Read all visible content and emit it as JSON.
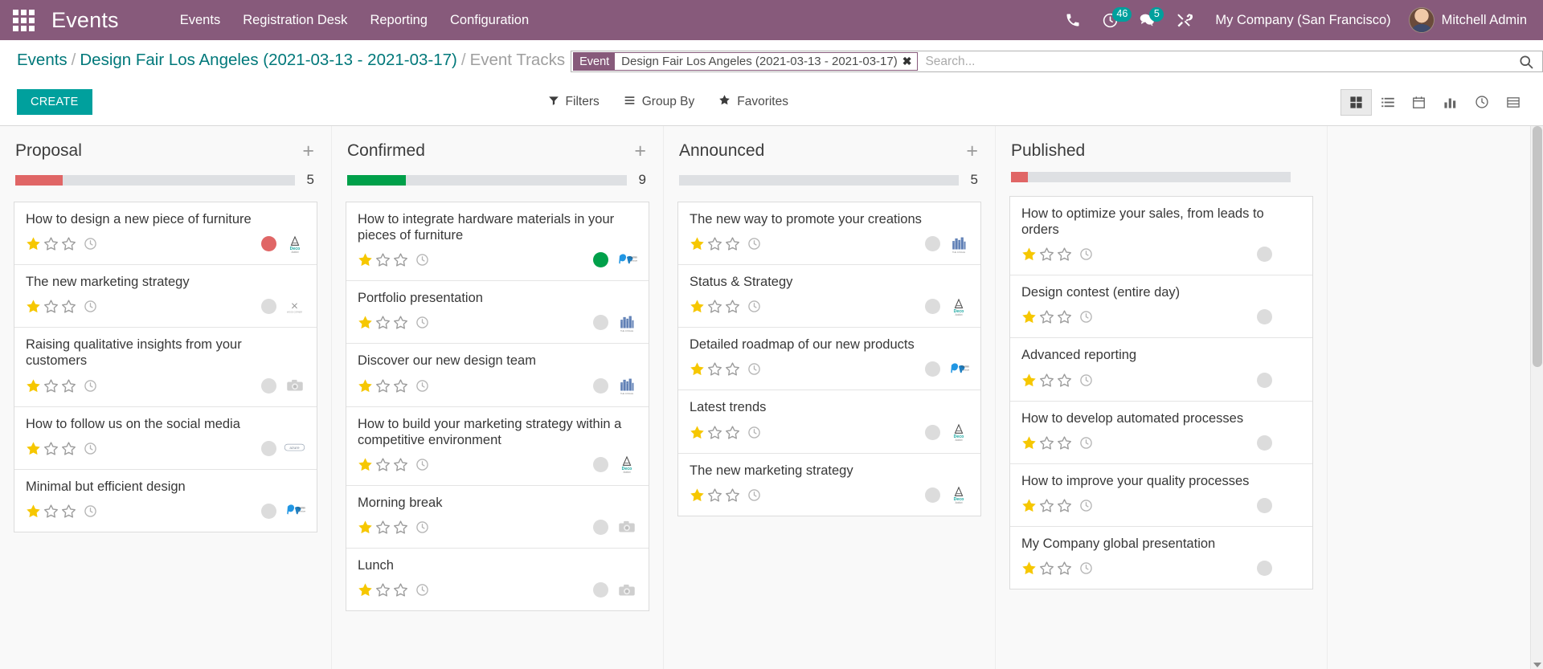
{
  "navbar": {
    "apps_icon": "apps-grid-icon",
    "brand": "Events",
    "menu": [
      {
        "label": "Events"
      },
      {
        "label": "Registration Desk"
      },
      {
        "label": "Reporting"
      },
      {
        "label": "Configuration"
      }
    ],
    "icons": {
      "phone": "phone-icon",
      "activity": "clock-icon",
      "activity_count": "46",
      "messages": "chat-icon",
      "messages_count": "5",
      "tools": "tools-icon"
    },
    "company": "My Company (San Francisco)",
    "user": "Mitchell Admin",
    "bg_color": "#875a7b",
    "badge_color": "#00a09d"
  },
  "breadcrumb": {
    "root": "Events",
    "parent": "Design Fair Los Angeles (2021-03-13 - 2021-03-17)",
    "current": "Event Tracks",
    "separator": "/"
  },
  "search": {
    "facet_label": "Event",
    "facet_value": "Design Fair Los Angeles (2021-03-13 - 2021-03-17)",
    "facet_close": "✖",
    "placeholder": "Search...",
    "value": "",
    "search_icon": "search-icon"
  },
  "toolbar": {
    "create_label": "CREATE",
    "filters_label": "Filters",
    "group_by_label": "Group By",
    "favorites_label": "Favorites",
    "create_color": "#00a09d",
    "views": [
      {
        "name": "kanban",
        "icon": "kanban-icon",
        "active": true
      },
      {
        "name": "list",
        "icon": "list-icon",
        "active": false
      },
      {
        "name": "calendar",
        "icon": "calendar-icon",
        "active": false
      },
      {
        "name": "graph",
        "icon": "graph-icon",
        "active": false
      },
      {
        "name": "gantt",
        "icon": "clock-circle-icon",
        "active": false
      },
      {
        "name": "pivot",
        "icon": "pivot-icon",
        "active": false
      }
    ]
  },
  "kanban": {
    "columns": [
      {
        "title": "Proposal",
        "count": "5",
        "progress_percent": 17,
        "progress_color": "#e06666",
        "add_icon": "plus-icon",
        "cards": [
          {
            "title": "How to design a new piece of furniture",
            "stars": 1,
            "dot_color": "#e06666",
            "logo": "deco-addict-logo",
            "clock": "clock-icon"
          },
          {
            "title": "The new marketing strategy",
            "stars": 1,
            "dot_color": "#dcdcdc",
            "logo": "wood-corner-logo",
            "clock": "clock-icon"
          },
          {
            "title": "Raising qualitative insights from your customers",
            "stars": 1,
            "dot_color": "#dcdcdc",
            "logo": "camera-logo",
            "clock": "clock-icon"
          },
          {
            "title": "How to follow us on the social media",
            "stars": 1,
            "dot_color": "#dcdcdc",
            "logo": "azure-interior-logo",
            "clock": "clock-icon"
          },
          {
            "title": "Minimal but efficient design",
            "stars": 1,
            "dot_color": "#dcdcdc",
            "logo": "gemini-furniture-logo",
            "clock": "clock-icon"
          }
        ]
      },
      {
        "title": "Confirmed",
        "count": "9",
        "progress_percent": 21,
        "progress_color": "#00a04a",
        "add_icon": "plus-icon",
        "cards": [
          {
            "title": "How to integrate hardware materials in your pieces of furniture",
            "stars": 1,
            "dot_color": "#00a04a",
            "logo": "gemini-furniture-logo",
            "clock": "clock-icon"
          },
          {
            "title": "Portfolio presentation",
            "stars": 1,
            "dot_color": "#dcdcdc",
            "logo": "city-logo",
            "clock": "clock-icon"
          },
          {
            "title": "Discover our new design team",
            "stars": 1,
            "dot_color": "#dcdcdc",
            "logo": "city-logo",
            "clock": "clock-icon"
          },
          {
            "title": "How to build your marketing strategy within a competitive environment",
            "stars": 1,
            "dot_color": "#dcdcdc",
            "logo": "deco-addict-logo",
            "clock": "clock-icon"
          },
          {
            "title": "Morning break",
            "stars": 1,
            "dot_color": "#dcdcdc",
            "logo": "camera-logo",
            "clock": "clock-icon"
          },
          {
            "title": "Lunch",
            "stars": 1,
            "dot_color": "#dcdcdc",
            "logo": "camera-logo",
            "clock": "clock-icon"
          }
        ]
      },
      {
        "title": "Announced",
        "count": "5",
        "progress_percent": 0,
        "progress_color": "#dee0e3",
        "add_icon": "plus-icon",
        "cards": [
          {
            "title": "The new way to promote your creations",
            "stars": 1,
            "dot_color": "#dcdcdc",
            "logo": "city-logo",
            "clock": "clock-icon"
          },
          {
            "title": "Status & Strategy",
            "stars": 1,
            "dot_color": "#dcdcdc",
            "logo": "deco-addict-logo",
            "clock": "clock-icon"
          },
          {
            "title": "Detailed roadmap of our new products",
            "stars": 1,
            "dot_color": "#dcdcdc",
            "logo": "gemini-furniture-logo",
            "clock": "clock-icon"
          },
          {
            "title": "Latest trends",
            "stars": 1,
            "dot_color": "#dcdcdc",
            "logo": "deco-addict-logo",
            "clock": "clock-icon"
          },
          {
            "title": "The new marketing strategy",
            "stars": 1,
            "dot_color": "#dcdcdc",
            "logo": "deco-addict-logo",
            "clock": "clock-icon"
          }
        ]
      },
      {
        "title": "Published",
        "count": "",
        "progress_percent": 6,
        "progress_color": "#e06666",
        "add_icon": "plus-icon",
        "cards": [
          {
            "title": "How to optimize your sales, from leads to orders",
            "stars": 1,
            "dot_color": "#dcdcdc",
            "logo": "",
            "clock": "clock-icon"
          },
          {
            "title": "Design contest (entire day)",
            "stars": 1,
            "dot_color": "#dcdcdc",
            "logo": "",
            "clock": "clock-icon"
          },
          {
            "title": "Advanced reporting",
            "stars": 1,
            "dot_color": "#dcdcdc",
            "logo": "",
            "clock": "clock-icon"
          },
          {
            "title": "How to develop automated processes",
            "stars": 1,
            "dot_color": "#dcdcdc",
            "logo": "",
            "clock": "clock-icon"
          },
          {
            "title": "How to improve your quality processes",
            "stars": 1,
            "dot_color": "#dcdcdc",
            "logo": "",
            "clock": "clock-icon"
          },
          {
            "title": "My Company global presentation",
            "stars": 1,
            "dot_color": "#dcdcdc",
            "logo": "",
            "clock": "clock-icon"
          }
        ]
      }
    ]
  }
}
